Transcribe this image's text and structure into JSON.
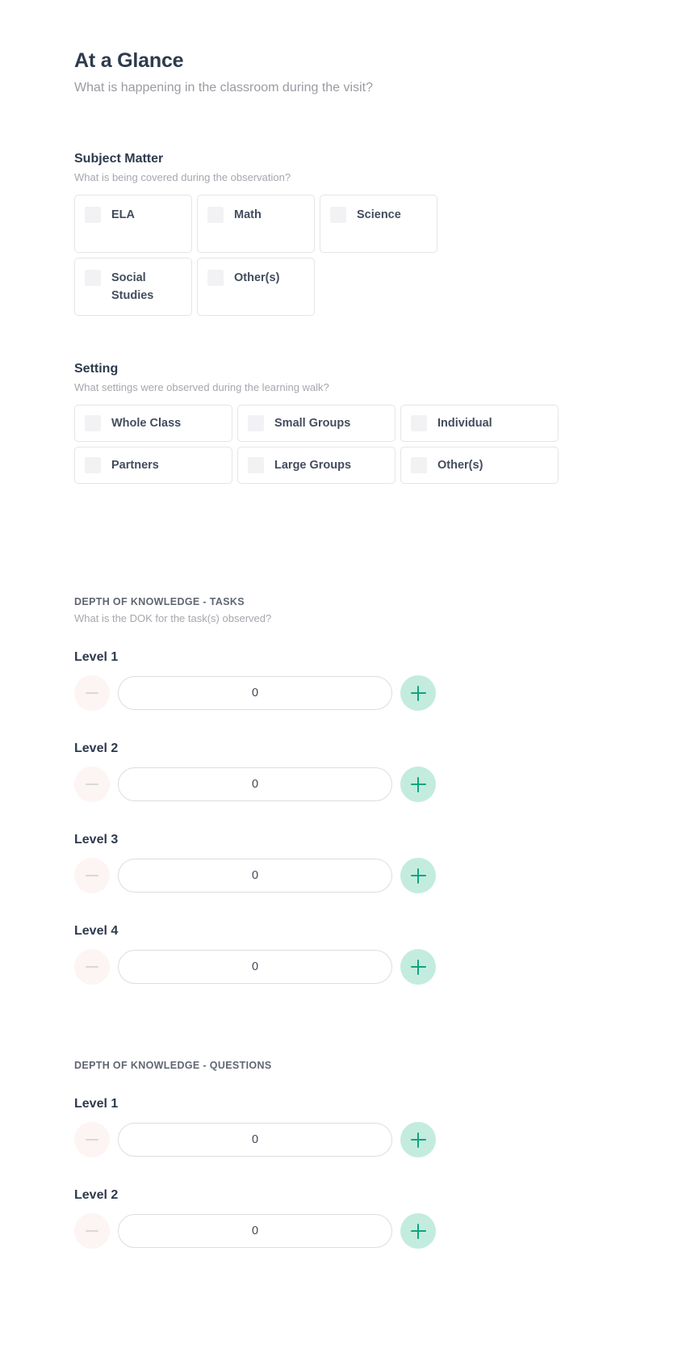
{
  "header": {
    "title": "At a Glance",
    "subtitle": "What is happening in the classroom during the visit?"
  },
  "subject_matter": {
    "title": "Subject Matter",
    "subtitle": "What is being covered during the observation?",
    "options": [
      {
        "label": "ELA",
        "checked": false
      },
      {
        "label": "Math",
        "checked": false
      },
      {
        "label": "Science",
        "checked": false
      },
      {
        "label": "Social Studies",
        "checked": false
      },
      {
        "label": "Other(s)",
        "checked": false
      }
    ]
  },
  "setting": {
    "title": "Setting",
    "subtitle": "What settings were observed during the learning walk?",
    "options": [
      {
        "label": "Whole Class",
        "checked": false
      },
      {
        "label": "Small Groups",
        "checked": false
      },
      {
        "label": "Individual",
        "checked": false
      },
      {
        "label": "Partners",
        "checked": false
      },
      {
        "label": "Large Groups",
        "checked": false
      },
      {
        "label": "Other(s)",
        "checked": false
      }
    ]
  },
  "dok_tasks": {
    "title": "DEPTH OF KNOWLEDGE - TASKS",
    "subtitle": "What is the DOK for the task(s) observed?",
    "levels": [
      {
        "label": "Level 1",
        "value": "0"
      },
      {
        "label": "Level 2",
        "value": "0"
      },
      {
        "label": "Level 3",
        "value": "0"
      },
      {
        "label": "Level 4",
        "value": "0"
      }
    ]
  },
  "dok_questions": {
    "title": "DEPTH OF KNOWLEDGE - QUESTIONS",
    "levels": [
      {
        "label": "Level 1",
        "value": "0"
      },
      {
        "label": "Level 2",
        "value": "0"
      }
    ]
  },
  "icons": {
    "decrement": "minus-icon",
    "increment": "plus-icon",
    "checkbox": "checkbox-icon"
  },
  "colors": {
    "heading": "#2e3a4d",
    "muted": "#a6a7ae",
    "increment_bg": "#c3ecdf",
    "increment_glyph": "#11a37f",
    "decrement_bg": "#fdf4f4",
    "decrement_glyph": "#d8d8da",
    "card_border": "#e4e5e7",
    "checkbox_bg": "#f2f2f4"
  }
}
